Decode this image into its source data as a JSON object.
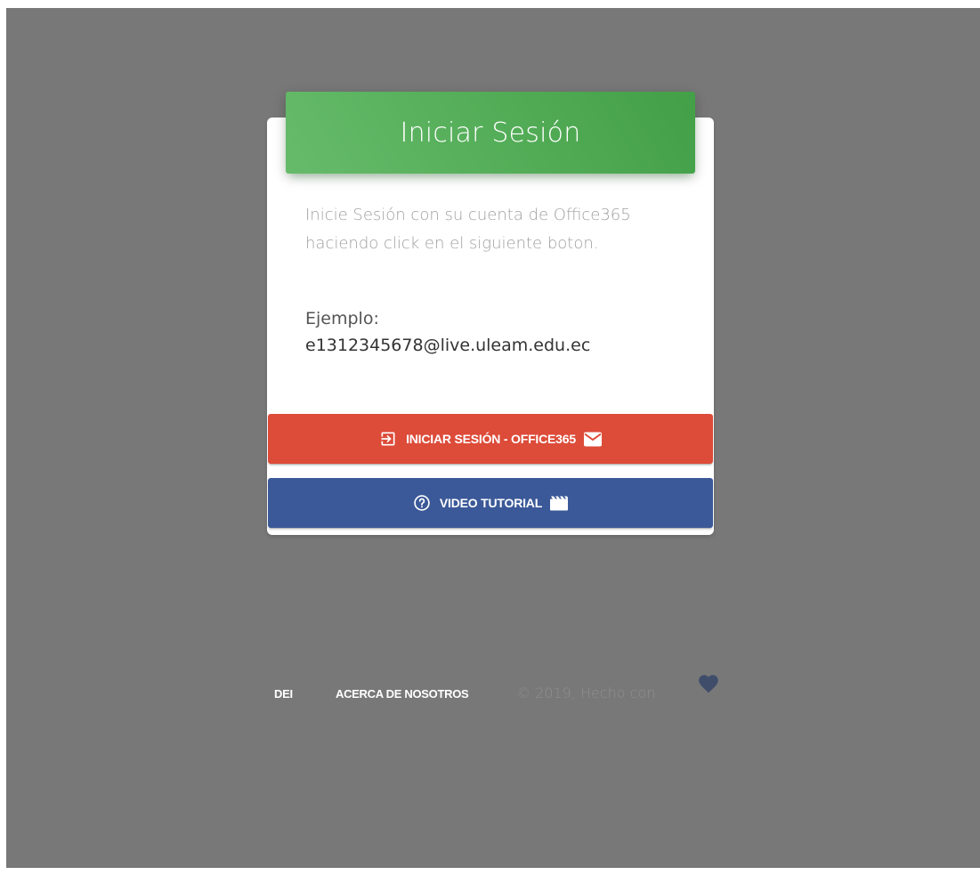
{
  "card": {
    "title": "Iniciar Sesión",
    "description": "Inicie Sesión con su cuenta de Office365 haciendo click en el siguiente boton.",
    "example_label": "Ejemplo:",
    "example_value": "e1312345678@live.uleam.edu.ec"
  },
  "buttons": {
    "login_label": "INICIAR SESIÓN - OFFICE365",
    "login_icons": [
      "login-icon",
      "mail-icon"
    ],
    "video_label": "VIDEO TUTORIAL",
    "video_icons": [
      "help-circle-icon",
      "movie-icon"
    ]
  },
  "footer": {
    "links": [
      "DEI",
      "ACERCA DE NOSOTROS"
    ],
    "copyright": "© 2019, Hecho con",
    "icon": "heart-icon"
  },
  "colors": {
    "background": "#787878",
    "header_green": "#4caf50",
    "login_red": "#dd4b39",
    "video_blue": "#3b5998",
    "heart": "#3f4d6b"
  }
}
